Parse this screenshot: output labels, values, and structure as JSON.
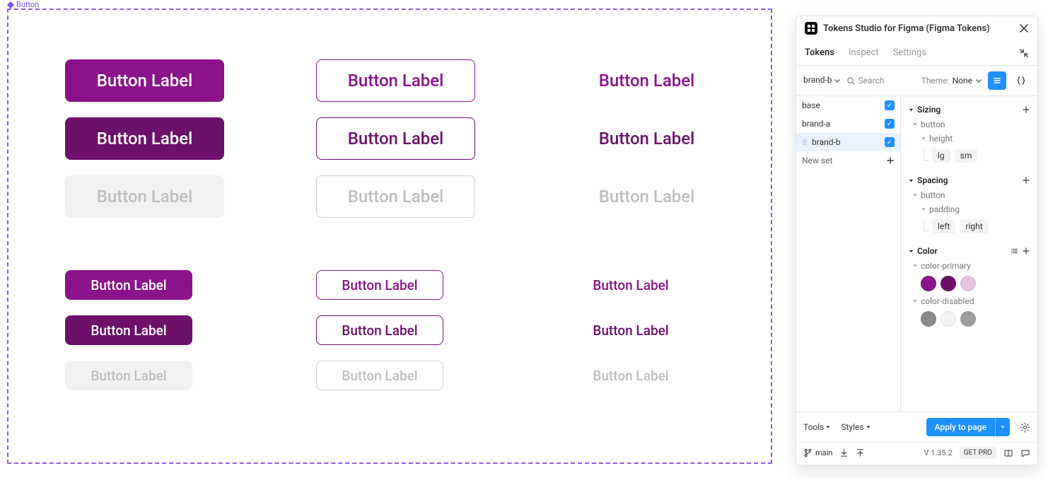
{
  "canvas": {
    "frame_label": "Button",
    "button_label": "Button Label"
  },
  "colors": {
    "primary_1": "#8A138B",
    "primary_2": "#6C106C",
    "primary_3": "#E2C4E2",
    "disabled_1": "#8A8A8A",
    "disabled_2": "#F4F4F4",
    "disabled_3": "#9E9E9E"
  },
  "panel": {
    "title": "Tokens Studio for Figma (Figma Tokens)",
    "tabs": {
      "tokens": "Tokens",
      "inspect": "Inspect",
      "settings": "Settings"
    },
    "set_dropdown": "brand-b",
    "search_placeholder": "Search",
    "theme_label": "Theme:",
    "theme_value": "None",
    "sets": {
      "base": "base",
      "brand_a": "brand-a",
      "brand_b": "brand-b",
      "new_set": "New set"
    },
    "groups": {
      "sizing": {
        "title": "Sizing",
        "button": "button",
        "height": "height",
        "lg": "lg",
        "sm": "sm"
      },
      "spacing": {
        "title": "Spacing",
        "button": "button",
        "padding": "padding",
        "left": "left",
        "right": "right"
      },
      "color": {
        "title": "Color",
        "primary": "color-primary",
        "disabled": "color-disabled"
      }
    },
    "footer": {
      "tools": "Tools",
      "styles": "Styles",
      "apply": "Apply to page",
      "branch": "main",
      "version": "V 1.35.2",
      "getpro": "GET PRO"
    }
  }
}
